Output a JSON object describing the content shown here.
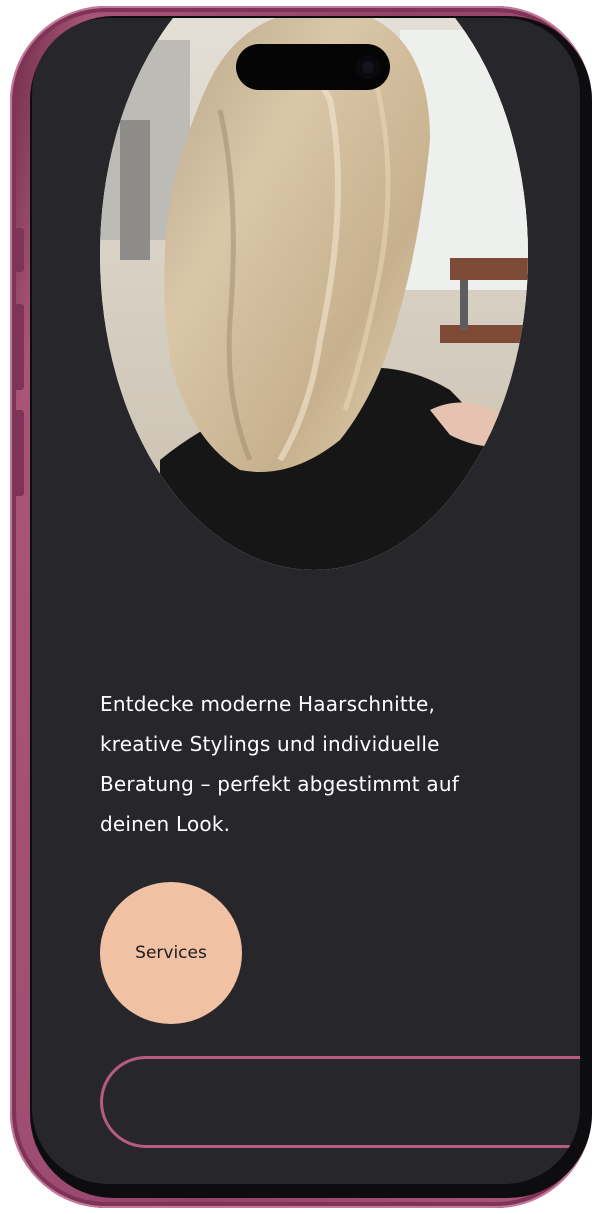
{
  "hero": {
    "image_description": "Oval photo of blonde shoulder-length hair in a salon"
  },
  "intro": {
    "text": "Entdecke moderne Haarschnitte, kreative Stylings und individuelle Beratung – perfekt abgestimmt auf deinen Look."
  },
  "cta": {
    "label": "Services"
  },
  "colors": {
    "frame": "#93426a",
    "screen_bg": "#27262b",
    "text": "#ffffff",
    "cta_bg": "#f1c1a4",
    "pill_border": "#b65c82"
  }
}
